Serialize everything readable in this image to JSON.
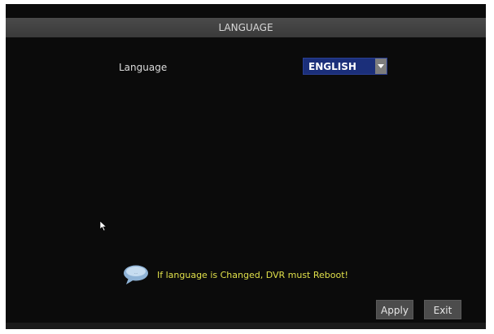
{
  "header": {
    "title": "LANGUAGE"
  },
  "language": {
    "label": "Language",
    "selected": "ENGLISH"
  },
  "notice": {
    "text": "If  language  is  Changed,  DVR  must  Reboot!"
  },
  "buttons": {
    "apply": "Apply",
    "exit": "Exit"
  },
  "icons": {
    "dropdown": "chevron-down-icon",
    "info": "speech-bubble-icon",
    "pointer": "cursor-icon"
  },
  "colors": {
    "select_bg": "#1b2f7a",
    "notice_text": "#e0e04a"
  }
}
